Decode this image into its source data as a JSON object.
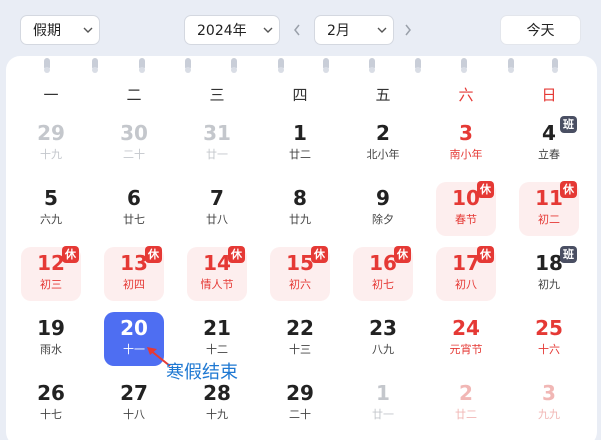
{
  "toolbar": {
    "holiday_select": "假期",
    "year_select": "2024年",
    "month_select": "2月",
    "today_button": "今天"
  },
  "weekdays": [
    "一",
    "二",
    "三",
    "四",
    "五",
    "六",
    "日"
  ],
  "weeks": [
    [
      {
        "day": "29",
        "sub": "十九",
        "other": true
      },
      {
        "day": "30",
        "sub": "二十",
        "other": true
      },
      {
        "day": "31",
        "sub": "廿一",
        "other": true
      },
      {
        "day": "1",
        "sub": "廿二"
      },
      {
        "day": "2",
        "sub": "北小年"
      },
      {
        "day": "3",
        "sub": "南小年",
        "red": true
      },
      {
        "day": "4",
        "sub": "立春",
        "badge": "班",
        "badge_type": "work"
      }
    ],
    [
      {
        "day": "5",
        "sub": "六九"
      },
      {
        "day": "6",
        "sub": "廿七"
      },
      {
        "day": "7",
        "sub": "廿八"
      },
      {
        "day": "8",
        "sub": "廿九"
      },
      {
        "day": "9",
        "sub": "除夕"
      },
      {
        "day": "10",
        "sub": "春节",
        "red": true,
        "badge": "休",
        "badge_type": "rest"
      },
      {
        "day": "11",
        "sub": "初二",
        "red": true,
        "badge": "休",
        "badge_type": "rest"
      }
    ],
    [
      {
        "day": "12",
        "sub": "初三",
        "red": true,
        "badge": "休",
        "badge_type": "rest"
      },
      {
        "day": "13",
        "sub": "初四",
        "red": true,
        "badge": "休",
        "badge_type": "rest"
      },
      {
        "day": "14",
        "sub": "情人节",
        "red": true,
        "badge": "休",
        "badge_type": "rest"
      },
      {
        "day": "15",
        "sub": "初六",
        "red": true,
        "badge": "休",
        "badge_type": "rest"
      },
      {
        "day": "16",
        "sub": "初七",
        "red": true,
        "badge": "休",
        "badge_type": "rest"
      },
      {
        "day": "17",
        "sub": "初八",
        "red": true,
        "badge": "休",
        "badge_type": "rest"
      },
      {
        "day": "18",
        "sub": "初九",
        "badge": "班",
        "badge_type": "work"
      }
    ],
    [
      {
        "day": "19",
        "sub": "雨水"
      },
      {
        "day": "20",
        "sub": "十一",
        "selected": true
      },
      {
        "day": "21",
        "sub": "十二"
      },
      {
        "day": "22",
        "sub": "十三"
      },
      {
        "day": "23",
        "sub": "八九"
      },
      {
        "day": "24",
        "sub": "元宵节",
        "red": true
      },
      {
        "day": "25",
        "sub": "十六",
        "red": true
      }
    ],
    [
      {
        "day": "26",
        "sub": "十七"
      },
      {
        "day": "27",
        "sub": "十八"
      },
      {
        "day": "28",
        "sub": "十九"
      },
      {
        "day": "29",
        "sub": "二十"
      },
      {
        "day": "1",
        "sub": "廿一",
        "other": true
      },
      {
        "day": "2",
        "sub": "廿二",
        "other": true,
        "red": true
      },
      {
        "day": "3",
        "sub": "九九",
        "other": true,
        "red": true
      }
    ]
  ],
  "annotation": "寒假结束",
  "colors": {
    "accent": "#4e6ef2",
    "holiday_red": "#e53935",
    "offday_bg": "#fdeeee",
    "work_badge": "#4a4f63",
    "annotation": "#1e78d2"
  }
}
